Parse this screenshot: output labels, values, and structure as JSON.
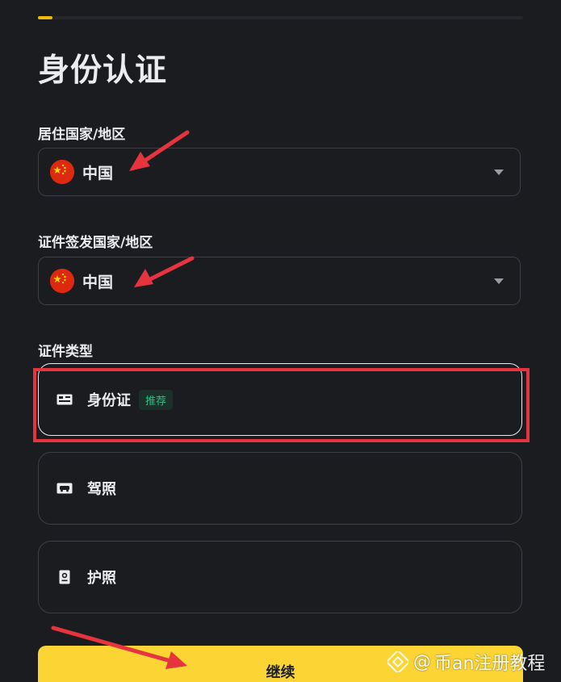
{
  "progress": {
    "fraction": 0.03
  },
  "page_title": "身份认证",
  "residence": {
    "label": "居住国家/地区",
    "value": "中国"
  },
  "issuing": {
    "label": "证件签发国家/地区",
    "value": "中国"
  },
  "doc_type": {
    "label": "证件类型",
    "options": [
      {
        "label": "身份证",
        "badge": "推荐",
        "icon": "id-card-icon",
        "selected": true
      },
      {
        "label": "驾照",
        "icon": "driver-license-icon",
        "selected": false
      },
      {
        "label": "护照",
        "icon": "passport-icon",
        "selected": false
      }
    ]
  },
  "continue_label": "继续",
  "watermark": {
    "at": "@",
    "text": "币an注册教程"
  },
  "colors": {
    "background": "#1b1c20",
    "accent_yellow": "#fcd535",
    "annotation_red": "#e5343d",
    "badge_green": "#2ebd85",
    "border": "#3c3e45"
  }
}
